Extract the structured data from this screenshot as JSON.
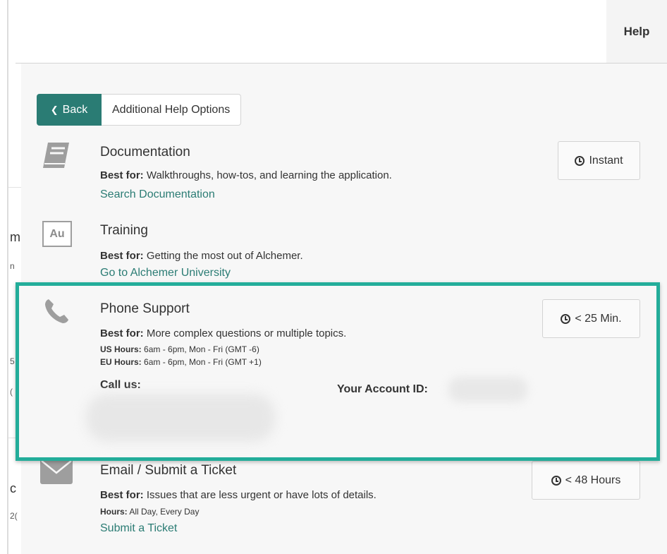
{
  "background": {
    "help_tab": "Help",
    "fragments": [
      "m",
      "n",
      "5",
      "(",
      "c",
      "2("
    ]
  },
  "panel": {
    "back_label": "Back",
    "crumb_label": "Additional Help Options"
  },
  "options": {
    "documentation": {
      "icon": "book-icon",
      "title": "Documentation",
      "best_for_label": "Best for:",
      "best_for": "Walkthroughs, how-tos, and learning the application.",
      "link": "Search Documentation",
      "time": "Instant"
    },
    "training": {
      "icon_text": "Au",
      "title": "Training",
      "best_for_label": "Best for:",
      "best_for": "Getting the most out of Alchemer.",
      "link": "Go to Alchemer University"
    },
    "phone": {
      "icon": "phone-icon",
      "title": "Phone Support",
      "best_for_label": "Best for:",
      "best_for": "More complex questions or multiple topics.",
      "us_label": "US Hours:",
      "us_hours": "6am - 6pm, Mon - Fri (GMT -6)",
      "eu_label": "EU Hours:",
      "eu_hours": "6am - 6pm, Mon - Fri (GMT +1)",
      "call_label": "Call us:",
      "account_label": "Your Account ID:",
      "time": "< 25 Min."
    },
    "email": {
      "icon": "envelope-icon",
      "title": "Email / Submit a Ticket",
      "best_for_label": "Best for:",
      "best_for": "Issues that are less urgent or have lots of details.",
      "hours_label": "Hours:",
      "hours": "All Day, Every Day",
      "link": "Submit a Ticket",
      "time": "< 48 Hours"
    }
  },
  "colors": {
    "accent": "#2a7c74",
    "highlight": "#23ad9a",
    "link": "#2b7c74"
  }
}
